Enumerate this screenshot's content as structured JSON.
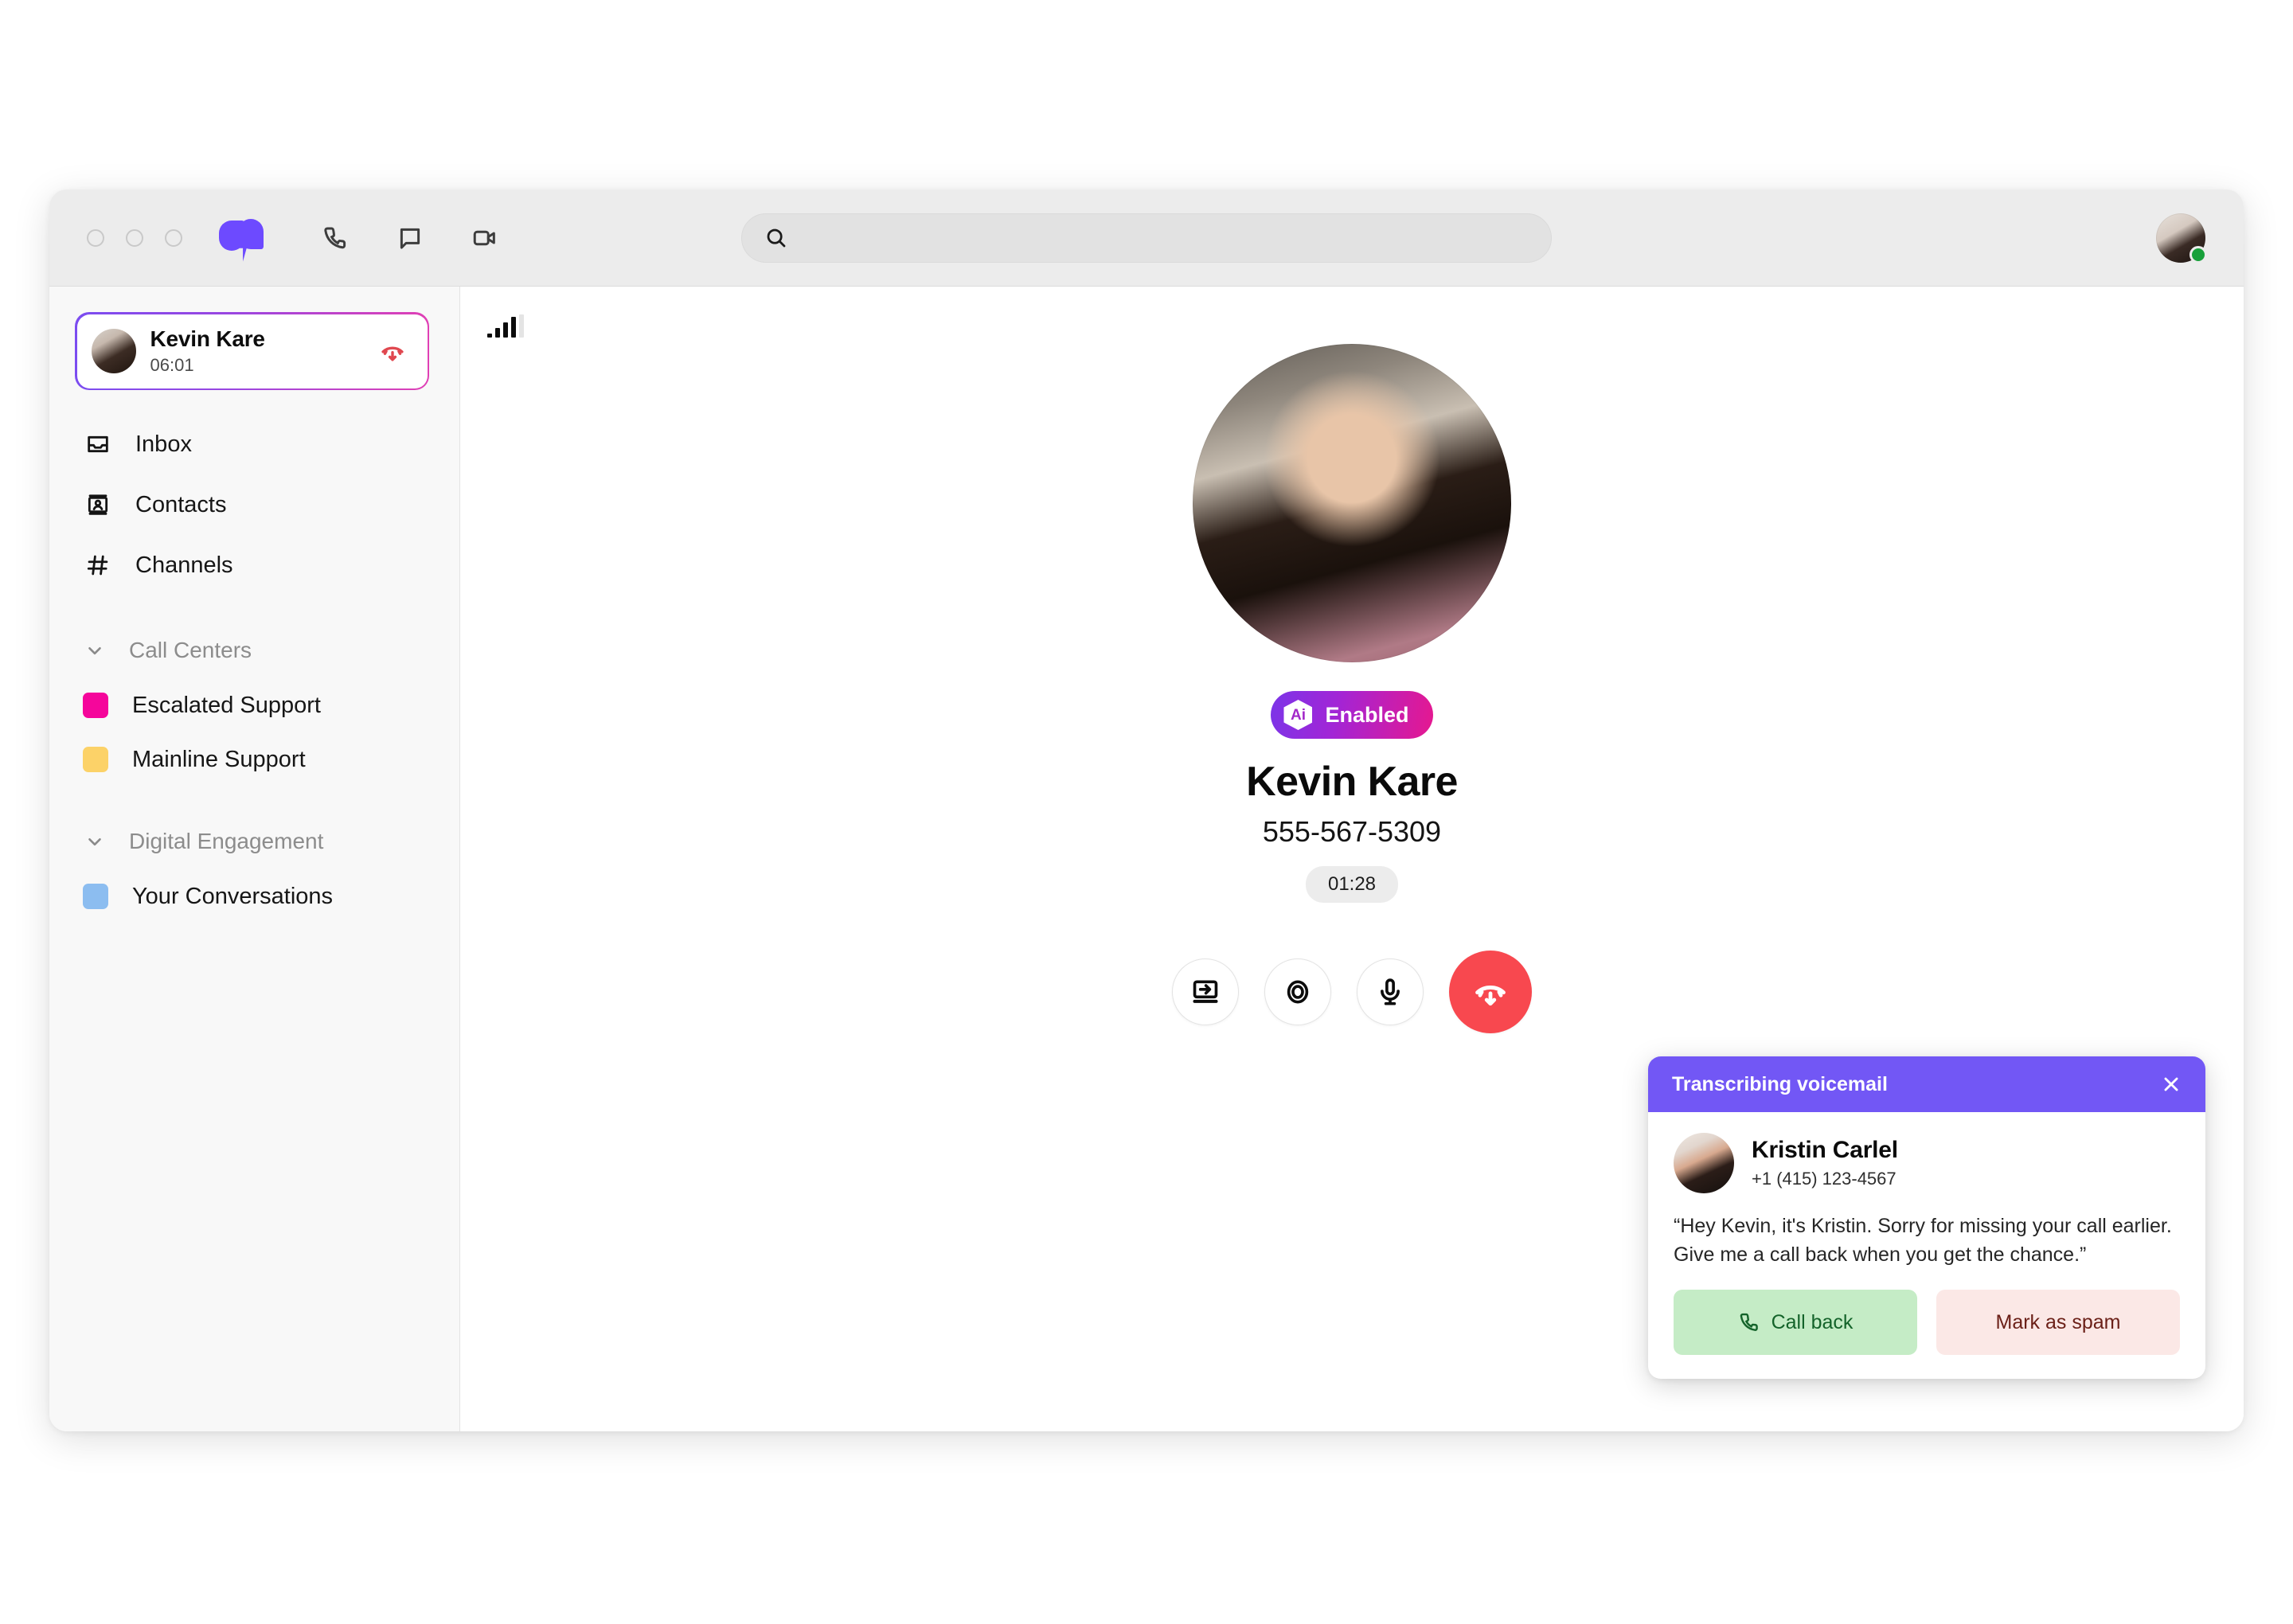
{
  "window": {
    "traffic_lights": [
      "close",
      "minimize",
      "maximize"
    ],
    "logo_name": "dialpad-logo"
  },
  "toolbar": {
    "icons": [
      {
        "name": "phone-icon",
        "label": "Phone"
      },
      {
        "name": "message-icon",
        "label": "Messages"
      },
      {
        "name": "video-icon",
        "label": "Video"
      }
    ],
    "search": {
      "placeholder": "",
      "value": ""
    },
    "user_avatar": {
      "name": "user-avatar",
      "status": "online",
      "status_color": "#17a03a"
    }
  },
  "sidebar": {
    "active_call": {
      "name": "Kevin Kare",
      "duration": "06:01",
      "hangup_label": "End call"
    },
    "nav": [
      {
        "label": "Inbox",
        "icon": "inbox-icon"
      },
      {
        "label": "Contacts",
        "icon": "contacts-icon"
      },
      {
        "label": "Channels",
        "icon": "hash-icon"
      }
    ],
    "sections": [
      {
        "label": "Call Centers",
        "items": [
          {
            "label": "Escalated Support",
            "color": "#f5069b"
          },
          {
            "label": "Mainline Support",
            "color": "#fcd268"
          }
        ]
      },
      {
        "label": "Digital Engagement",
        "items": [
          {
            "label": "Your Conversations",
            "color": "#8cbdf0"
          }
        ]
      }
    ]
  },
  "main": {
    "signal": {
      "name": "signal-strength",
      "bars_filled": 4,
      "bars_total": 5
    },
    "call": {
      "badge_icon_text": "Ai",
      "badge_label": "Enabled",
      "name": "Kevin Kare",
      "number": "555-567-5309",
      "duration": "01:28"
    },
    "controls": [
      {
        "name": "transfer-call-button",
        "icon": "transfer-icon"
      },
      {
        "name": "record-call-button",
        "icon": "record-icon"
      },
      {
        "name": "mute-button",
        "icon": "microphone-icon"
      },
      {
        "name": "hangup-button",
        "icon": "hangup-icon"
      }
    ]
  },
  "voicemail_toast": {
    "title": "Transcribing voicemail",
    "close_label": "Close",
    "caller_name": "Kristin Carlel",
    "caller_number": "+1 (415) 123-4567",
    "transcript": "“Hey Kevin, it's Kristin. Sorry for missing your call earlier. Give me a call back when you get the chance.”",
    "call_back_label": "Call back",
    "mark_spam_label": "Mark as spam",
    "header_color": "#7257f5"
  }
}
